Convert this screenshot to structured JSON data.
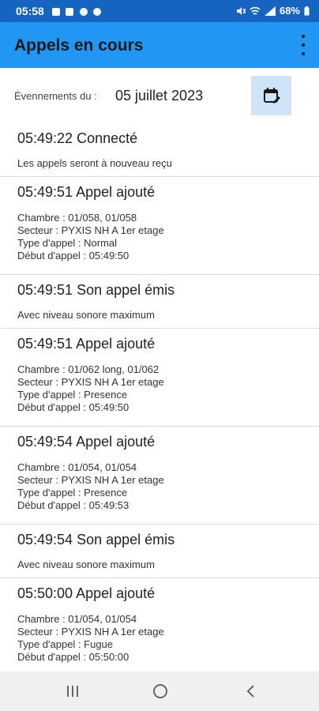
{
  "status_bar": {
    "time": "05:58",
    "battery": "68%"
  },
  "app_bar": {
    "title": "Appels en cours",
    "menu_icon": "more-vert-icon"
  },
  "date_filter": {
    "label": "Évennements du :",
    "date": "05 juillet 2023",
    "button_icon": "calendar-edit-icon"
  },
  "events": [
    {
      "title": "05:49:22 Connecté",
      "lines": [
        "Les appels seront à nouveau reçu"
      ]
    },
    {
      "title": "05:49:51 Appel ajouté",
      "lines": [
        "Chambre : 01/058, 01/058",
        "Secteur : PYXIS NH A 1er etage",
        "Type d'appel : Normal",
        "Début d'appel : 05:49:50"
      ]
    },
    {
      "title": "05:49:51 Son appel émis",
      "lines": [
        "Avec niveau sonore maximum"
      ]
    },
    {
      "title": "05:49:51 Appel ajouté",
      "lines": [
        "Chambre : 01/062 long, 01/062",
        "Secteur : PYXIS NH A 1er etage",
        "Type d'appel : Presence",
        "Début d'appel : 05:49:50"
      ]
    },
    {
      "title": "05:49:54 Appel ajouté",
      "lines": [
        "Chambre : 01/054, 01/054",
        "Secteur : PYXIS NH A 1er etage",
        "Type d'appel : Presence",
        "Début d'appel : 05:49:53"
      ]
    },
    {
      "title": "05:49:54 Son appel émis",
      "lines": [
        "Avec niveau sonore maximum"
      ]
    },
    {
      "title": "05:50:00 Appel ajouté",
      "lines": [
        "Chambre : 01/054, 01/054",
        "Secteur : PYXIS NH A 1er etage",
        "Type d'appel : Fugue",
        "Début d'appel : 05:50:00"
      ]
    }
  ],
  "nav_bar": {
    "items": [
      "recents-icon",
      "home-icon",
      "back-icon"
    ]
  },
  "colors": {
    "status_bar": "#1565c0",
    "app_bar": "#2196f3",
    "calendar_button": "#cfe5f7"
  }
}
